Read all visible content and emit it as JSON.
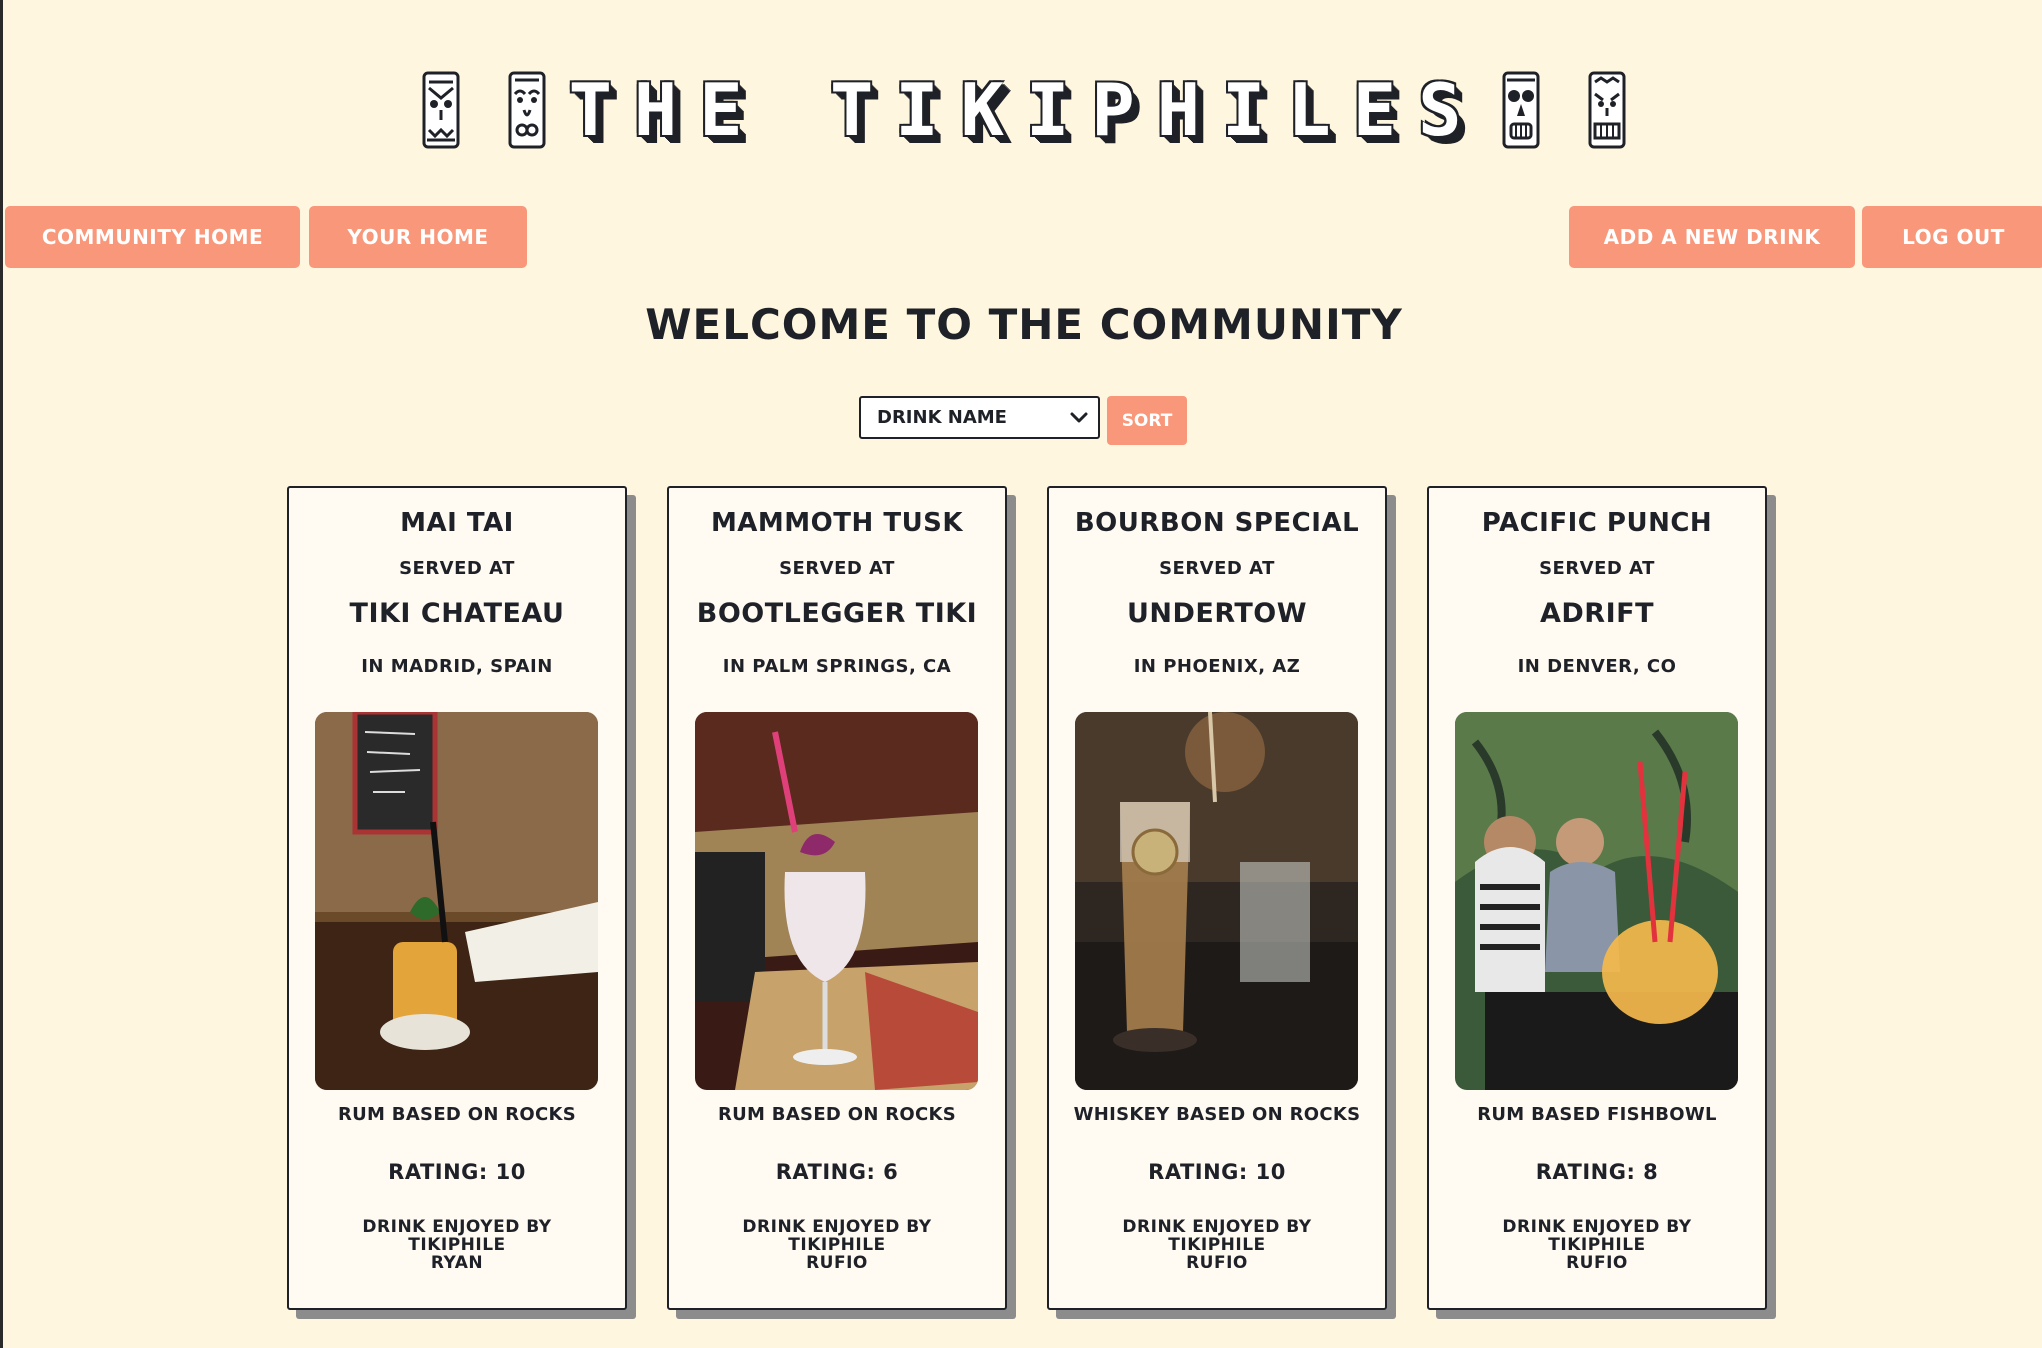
{
  "header": {
    "title": "THE TIKIPHILES",
    "icons": [
      "tiki-mask-icon",
      "tiki-mask-icon",
      "tiki-mask-icon",
      "tiki-mask-icon"
    ]
  },
  "nav": {
    "community_home": "Community Home",
    "your_home": "Your Home",
    "add_drink": "Add a New Drink",
    "log_out": "Log Out"
  },
  "welcome": "Welcome to the Community",
  "sort": {
    "selected": "Drink Name",
    "button": "Sort"
  },
  "colors": {
    "background": "#fef6df",
    "accent": "#f8977a",
    "text": "#1e2127",
    "card": "#fffaf2"
  },
  "drinks": [
    {
      "name": "Mai Tai",
      "served_at_label": "Served At",
      "venue": "Tiki Chateau",
      "location": "In Madrid, Spain",
      "photo": "cocktail-photo-mai-tai",
      "style": "Rum Based On Rocks",
      "rating": "Rating: 10",
      "enjoyed_line1": "Drink Enjoyed By",
      "enjoyed_line2": "Tikiphile",
      "enjoyed_by": "Ryan"
    },
    {
      "name": "Mammoth Tusk",
      "served_at_label": "Served At",
      "venue": "Bootlegger Tiki",
      "location": "In Palm Springs, CA",
      "photo": "cocktail-photo-mammoth-tusk",
      "style": "Rum Based On Rocks",
      "rating": "Rating: 6",
      "enjoyed_line1": "Drink Enjoyed By",
      "enjoyed_line2": "Tikiphile",
      "enjoyed_by": "Rufio"
    },
    {
      "name": "Bourbon Special",
      "served_at_label": "Served At",
      "venue": "Undertow",
      "location": "In Phoenix, AZ",
      "photo": "cocktail-photo-bourbon-special",
      "style": "Whiskey Based On Rocks",
      "rating": "Rating: 10",
      "enjoyed_line1": "Drink Enjoyed By",
      "enjoyed_line2": "Tikiphile",
      "enjoyed_by": "Rufio"
    },
    {
      "name": "Pacific Punch",
      "served_at_label": "Served At",
      "venue": "Adrift",
      "location": "In Denver, CO",
      "photo": "cocktail-photo-pacific-punch",
      "style": "Rum Based Fishbowl",
      "rating": "Rating: 8",
      "enjoyed_line1": "Drink Enjoyed By",
      "enjoyed_line2": "Tikiphile",
      "enjoyed_by": "Rufio"
    }
  ]
}
